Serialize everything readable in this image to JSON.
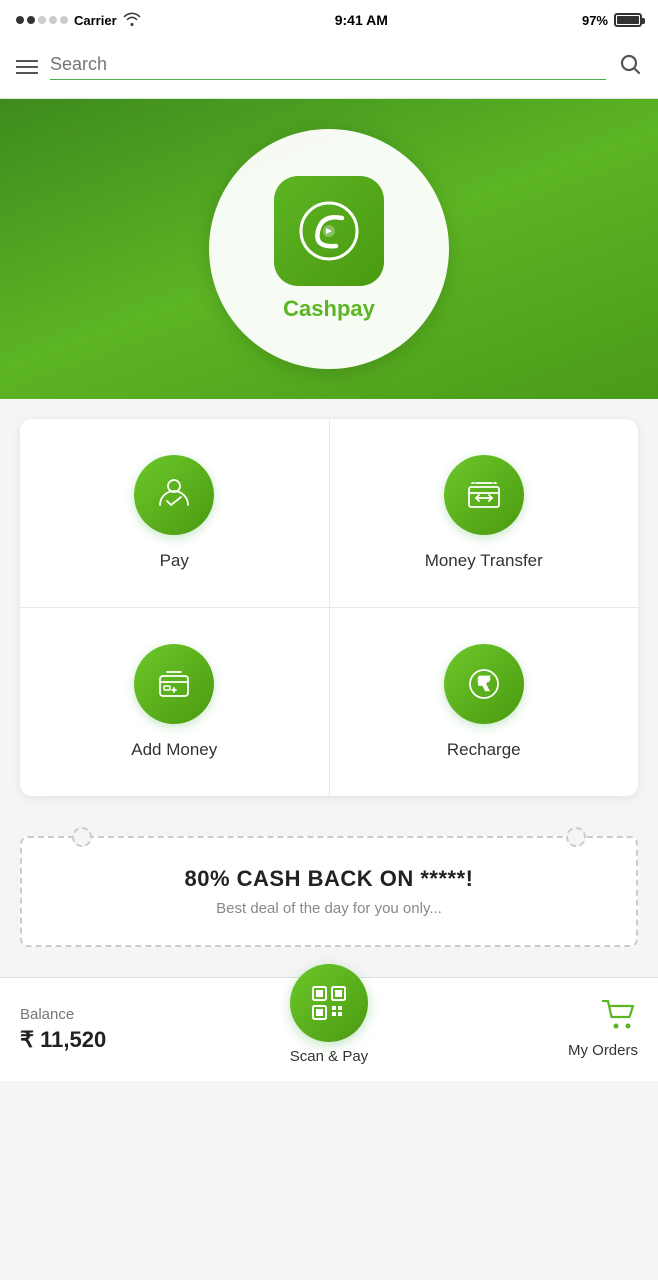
{
  "statusBar": {
    "carrier": "Carrier",
    "time": "9:41 AM",
    "battery": "97%"
  },
  "searchBar": {
    "placeholder": "Search"
  },
  "hero": {
    "appName": "Cashpay"
  },
  "grid": {
    "items": [
      {
        "id": "pay",
        "label": "Pay",
        "icon": "pay"
      },
      {
        "id": "money-transfer",
        "label": "Money Transfer",
        "icon": "bank"
      },
      {
        "id": "add-money",
        "label": "Add Money",
        "icon": "wallet"
      },
      {
        "id": "recharge",
        "label": "Recharge",
        "icon": "rupee"
      }
    ]
  },
  "promo": {
    "title": "80% CASH BACK ON *****!",
    "subtitle": "Best deal of the day for you only..."
  },
  "bottomBar": {
    "balanceLabel": "Balance",
    "balanceAmount": "₹ 11,520",
    "scanPayLabel": "Scan & Pay",
    "myOrdersLabel": "My Orders"
  }
}
